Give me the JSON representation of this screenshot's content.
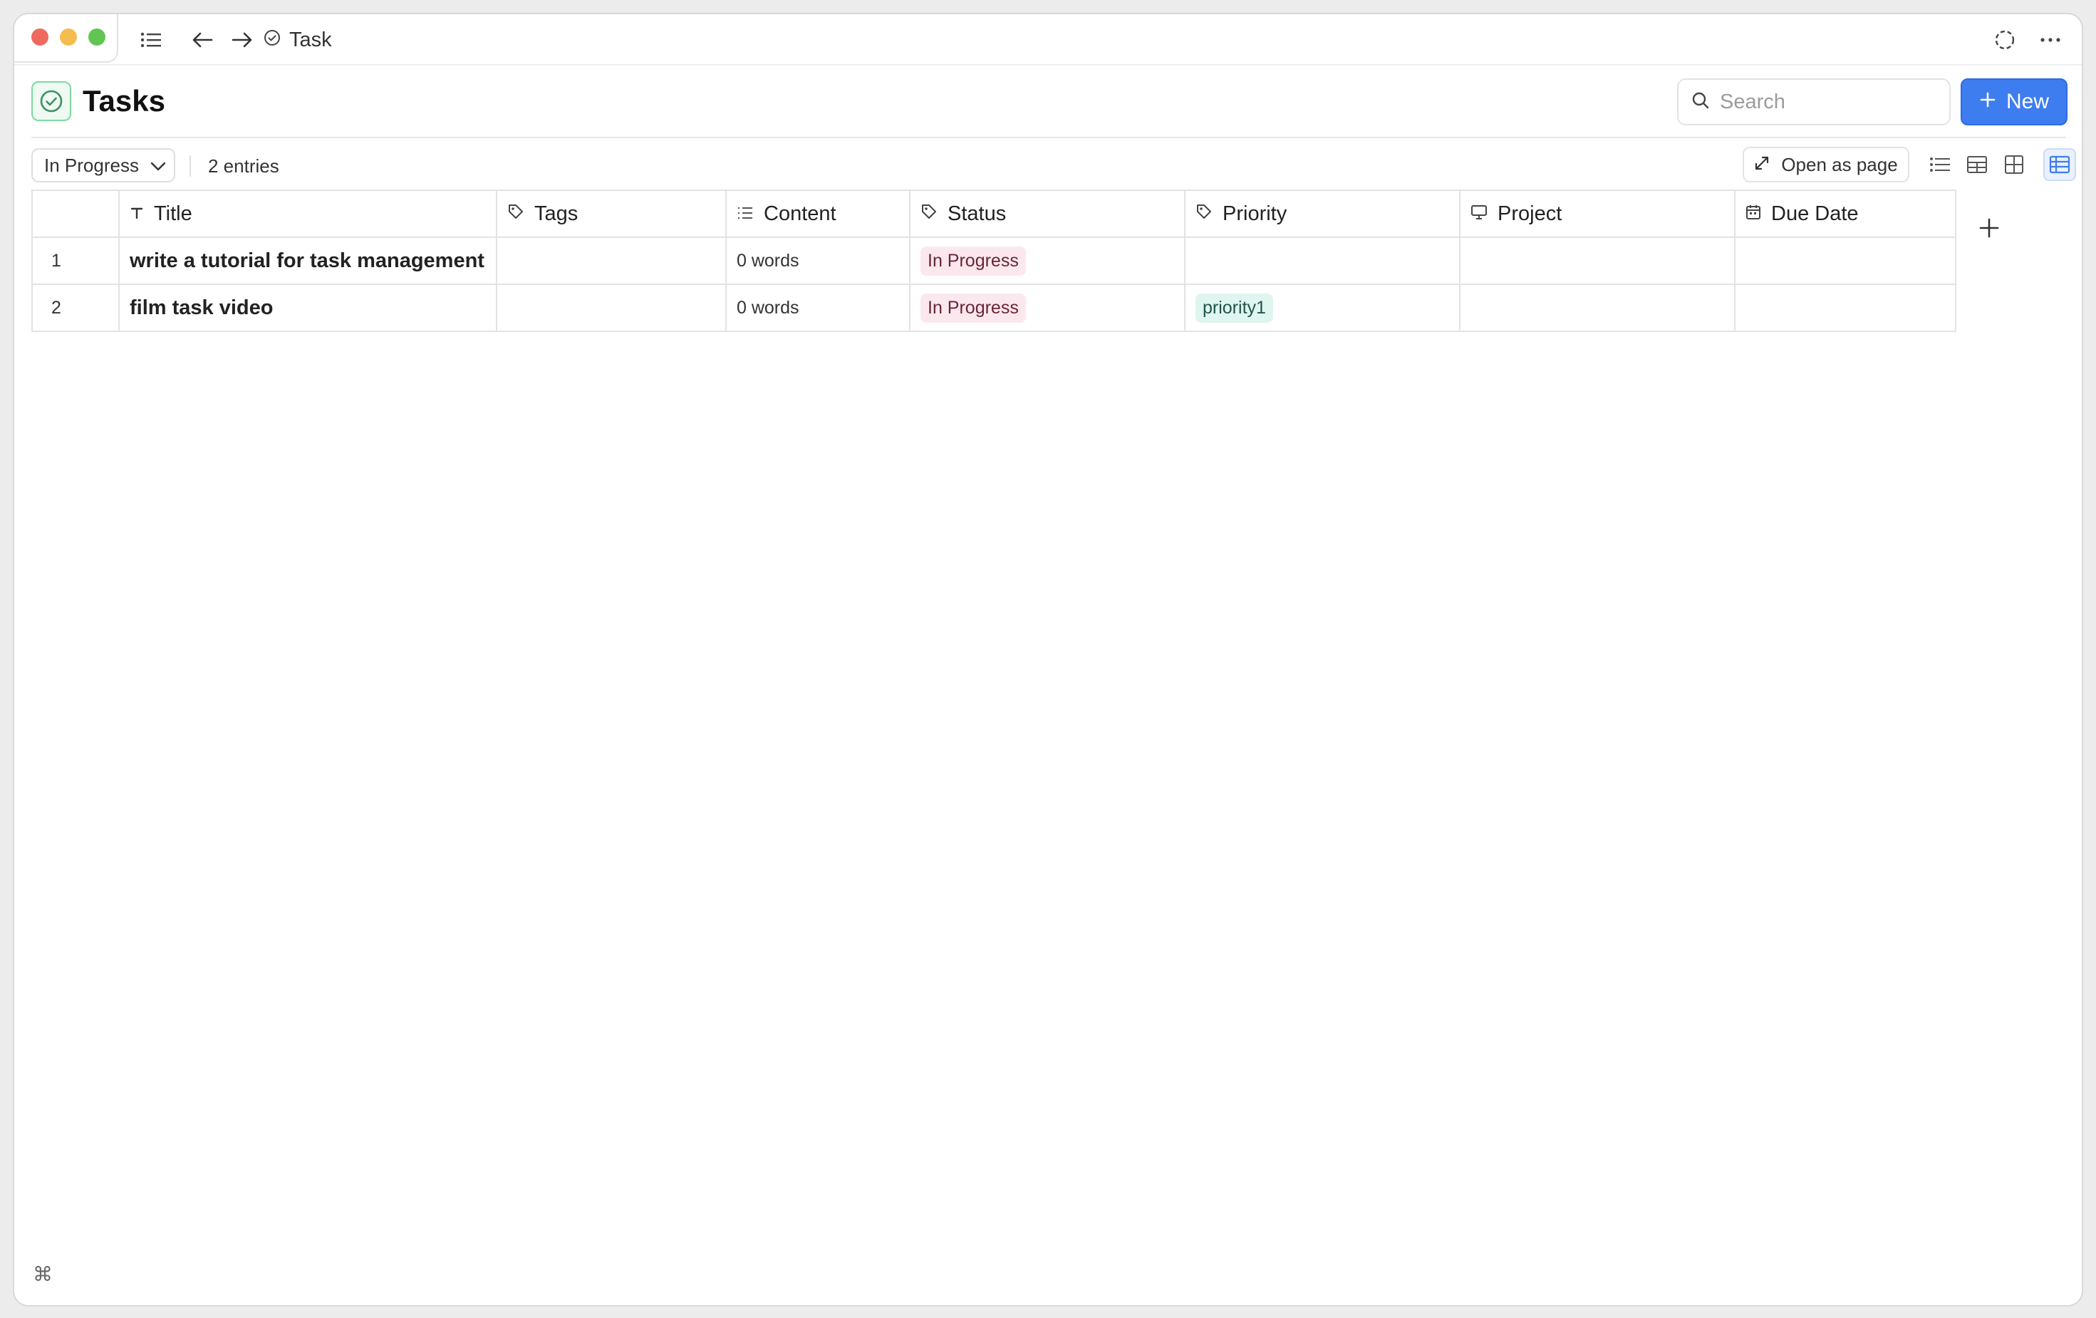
{
  "window": {
    "breadcrumb_title": "Task"
  },
  "header": {
    "title": "Tasks",
    "search_placeholder": "Search",
    "new_button_label": "New"
  },
  "toolbar": {
    "filter_value": "In Progress",
    "entries_text": "2 entries",
    "open_as_page_label": "Open as page",
    "views": [
      "list-view-icon",
      "gallery-view-icon",
      "board-view-icon",
      "table-view-icon"
    ],
    "active_view": "table"
  },
  "table": {
    "columns": [
      {
        "label": "",
        "icon": "none"
      },
      {
        "label": "Title",
        "icon": "text-type-icon"
      },
      {
        "label": "Tags",
        "icon": "tag-icon"
      },
      {
        "label": "Content",
        "icon": "list-icon"
      },
      {
        "label": "Status",
        "icon": "tag-icon"
      },
      {
        "label": "Priority",
        "icon": "tag-icon"
      },
      {
        "label": "Project",
        "icon": "monitor-icon"
      },
      {
        "label": "Due Date",
        "icon": "calendar-icon"
      }
    ],
    "rows": [
      {
        "num": "1",
        "title": "write a tutorial for task management",
        "tags": "",
        "content": "0 words",
        "status": "In Progress",
        "priority": "",
        "project": "",
        "due_date": ""
      },
      {
        "num": "2",
        "title": "film task video",
        "tags": "",
        "content": "0 words",
        "status": "In Progress",
        "priority": "priority1",
        "project": "",
        "due_date": ""
      }
    ]
  },
  "footer": {
    "command_glyph": "⌘"
  },
  "colors": {
    "accent": "#3d7df0",
    "status_tag_bg": "#fbe8ef",
    "priority_tag_bg": "#dff5f0",
    "page_icon_green": "#4caf7a"
  }
}
